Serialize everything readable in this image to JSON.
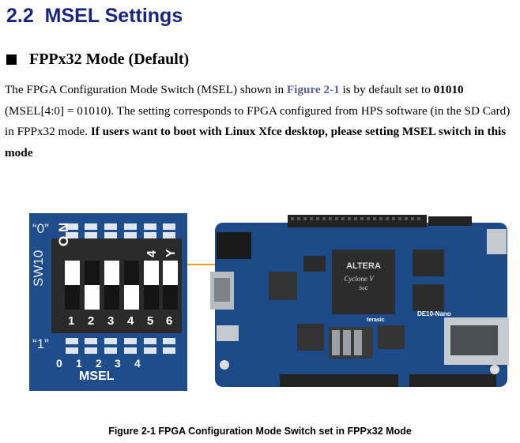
{
  "section": {
    "number": "2.2",
    "title": "MSEL Settings"
  },
  "subsection": {
    "title": "FPPx32 Mode (Default)"
  },
  "paragraph": {
    "p1": "The FPGA Configuration Mode Switch (MSEL) shown in ",
    "link": "Figure 2-1",
    "p2": " is by default set to ",
    "value_bold": "01010",
    "p3": " (MSEL[4:0] = 01010). The setting corresponds to FPGA configured from HPS software (in the SD Card) in FPPx32 mode. ",
    "emph": "If users want to boot with Linux Xfce desktop, please setting MSEL switch in this mode"
  },
  "switch": {
    "label_top": "“0”",
    "label_bottom": "“1”",
    "side_label": "SW10",
    "on_text": "O N",
    "four_text": "4",
    "y_text": "Y",
    "positions": [
      "1",
      "2",
      "3",
      "4",
      "5",
      "6"
    ],
    "msel_positions": [
      "0",
      "1",
      "2",
      "3",
      "4"
    ],
    "msel_label": "MSEL",
    "states": [
      0,
      1,
      0,
      1,
      0,
      0
    ]
  },
  "board": {
    "fpga_brand": "ALTERA",
    "fpga_name": "Cyclone V",
    "fpga_sub": "SoC",
    "board_name": "DE10-Nano",
    "maker": "terasic"
  },
  "caption": "Figure 2-1 FPGA Configuration Mode Switch set in FPPx32 Mode",
  "colors": {
    "heading": "#1a237e",
    "link": "#5b5f97",
    "panel": "#1f4d8c",
    "board": "#1b4a86",
    "callout": "#f0a020"
  }
}
